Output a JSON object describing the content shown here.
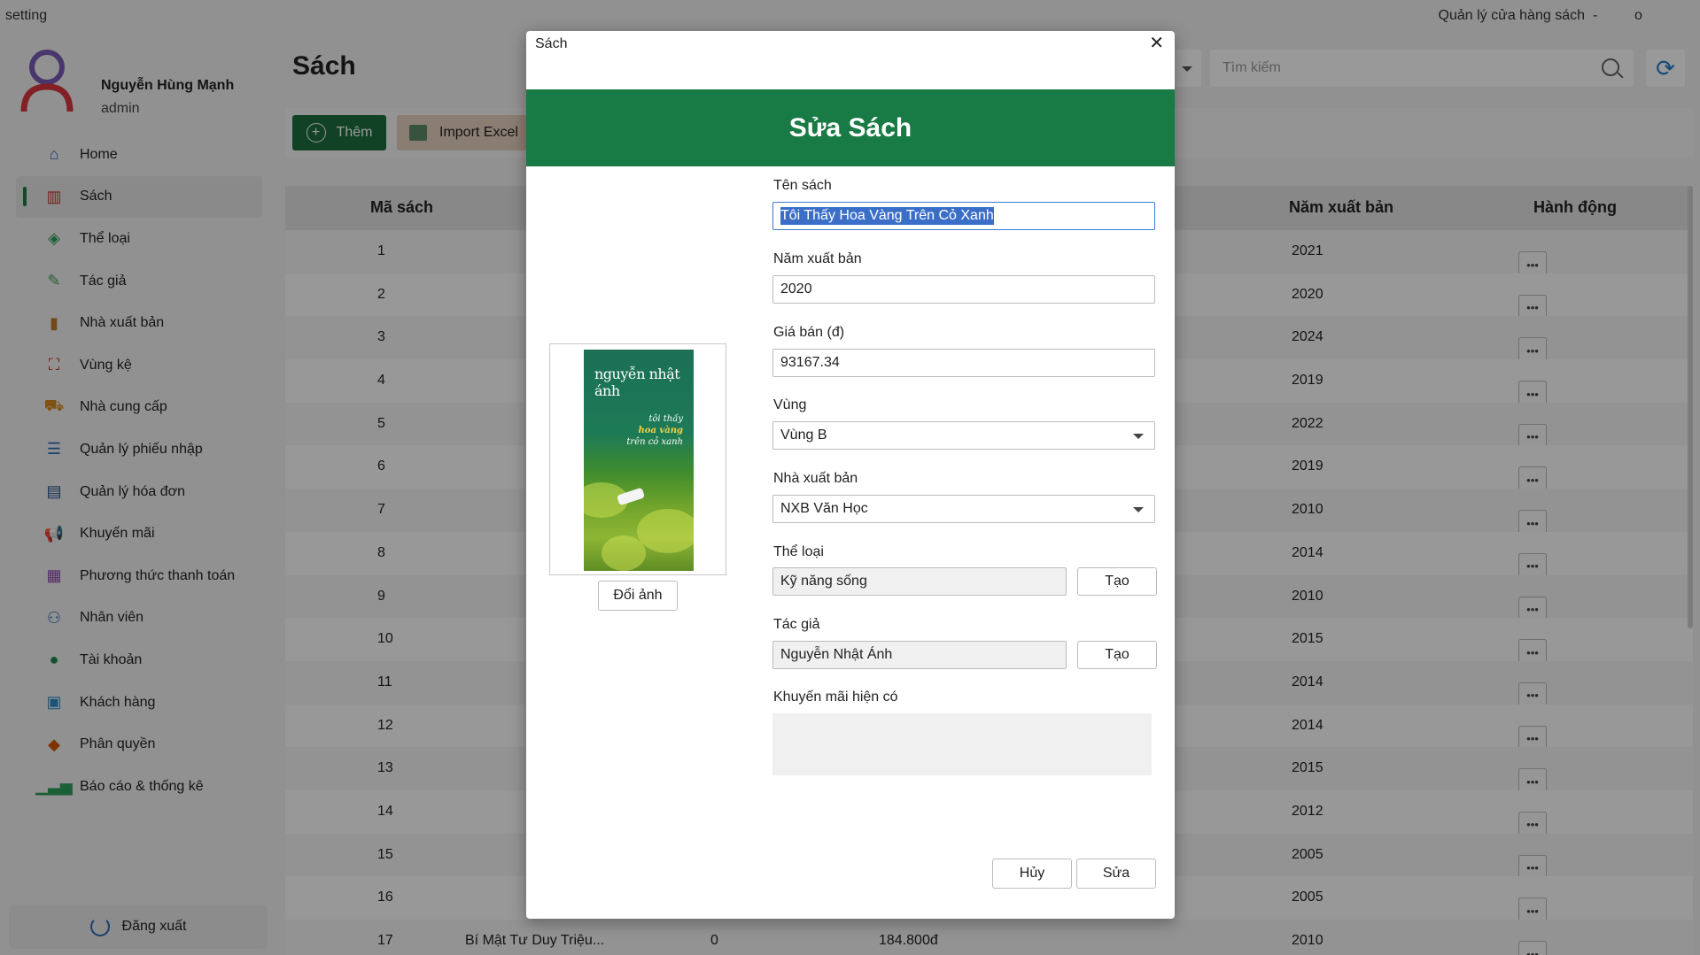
{
  "window": {
    "left_title": "setting",
    "right_title": "Quản lý cửa hàng sách",
    "minimize": "-",
    "maximize": "o"
  },
  "user": {
    "name": "Nguyễn Hùng Mạnh",
    "role": "admin"
  },
  "sidebar": {
    "items": [
      {
        "label": "Home",
        "icon": "home-icon",
        "color": "#2a6ab5",
        "glyph": "⌂"
      },
      {
        "label": "Sách",
        "icon": "books-icon",
        "color": "#c0392b",
        "glyph": "▥",
        "active": true
      },
      {
        "label": "Thể loại",
        "icon": "shapes-icon",
        "color": "#2e9e5b",
        "glyph": "◈"
      },
      {
        "label": "Tác giả",
        "icon": "author-icon",
        "color": "#4a9e5c",
        "glyph": "✎"
      },
      {
        "label": "Nhà xuất bản",
        "icon": "publisher-icon",
        "color": "#c07a2b",
        "glyph": "▮"
      },
      {
        "label": "Vùng kệ",
        "icon": "shelf-area-icon",
        "color": "#c0392b",
        "glyph": "⛶"
      },
      {
        "label": "Nhà cung cấp",
        "icon": "supplier-icon",
        "color": "#d48a1e",
        "glyph": "⛟"
      },
      {
        "label": "Quản lý phiếu nhập",
        "icon": "checklist-icon",
        "color": "#2a6ab5",
        "glyph": "☰"
      },
      {
        "label": "Quản lý hóa đơn",
        "icon": "invoice-icon",
        "color": "#1e4e8c",
        "glyph": "▤"
      },
      {
        "label": "Khuyến mãi",
        "icon": "megaphone-icon",
        "color": "#c0392b",
        "glyph": "📢"
      },
      {
        "label": "Phương thức thanh toán",
        "icon": "payment-icon",
        "color": "#8e44ad",
        "glyph": "▦"
      },
      {
        "label": "Nhân viên",
        "icon": "staff-icon",
        "color": "#2a6ab5",
        "glyph": "⚇"
      },
      {
        "label": "Tài khoản",
        "icon": "account-icon",
        "color": "#1e8a4c",
        "glyph": "●"
      },
      {
        "label": "Khách hàng",
        "icon": "customer-icon",
        "color": "#2a8ac8",
        "glyph": "▣"
      },
      {
        "label": "Phân quyền",
        "icon": "layers-icon",
        "color": "#d35400",
        "glyph": "◆"
      },
      {
        "label": "Báo cáo & thống kê",
        "icon": "chart-icon",
        "color": "#2e9e5b",
        "glyph": "▁▃▅"
      }
    ],
    "logout": "Đăng xuất"
  },
  "main": {
    "title": "Sách",
    "add_label": "Thêm",
    "import_label": "Import Excel",
    "search_placeholder": "Tìm kiếm",
    "columns": {
      "id": "Mã sách",
      "year": "Năm xuất bản",
      "actions": "Hành động"
    },
    "rows": [
      {
        "id": "1",
        "year": "2021"
      },
      {
        "id": "2",
        "year": "2020"
      },
      {
        "id": "3",
        "year": "2024"
      },
      {
        "id": "4",
        "year": "2019"
      },
      {
        "id": "5",
        "year": "2022"
      },
      {
        "id": "6",
        "year": "2019"
      },
      {
        "id": "7",
        "year": "2010"
      },
      {
        "id": "8",
        "year": "2014"
      },
      {
        "id": "9",
        "year": "2010"
      },
      {
        "id": "10",
        "year": "2015"
      },
      {
        "id": "11",
        "year": "2014"
      },
      {
        "id": "12",
        "year": "2014"
      },
      {
        "id": "13",
        "year": "2015"
      },
      {
        "id": "14",
        "year": "2012"
      },
      {
        "id": "15",
        "year": "2005"
      },
      {
        "id": "16",
        "year": "2005"
      },
      {
        "id": "17",
        "year": "2010",
        "title": "Bí Mật Tư Duy Triệu...",
        "qty": "0",
        "price": "184.800đ"
      }
    ]
  },
  "dialog": {
    "window_title": "Sách",
    "close": "✕",
    "header": "Sửa Sách",
    "cover": {
      "author_line": "nguyễn nhật ánh",
      "title_1": "tôi thấy",
      "title_2": "hoa vàng",
      "title_3": "trên cỏ xanh"
    },
    "change_image": "Đổi ảnh",
    "fields": {
      "name_label": "Tên sách",
      "name_value": "Tôi Thấy Hoa Vàng Trên Cỏ Xanh",
      "year_label": "Năm xuất bản",
      "year_value": "2020",
      "price_label": "Giá bán (đ)",
      "price_value": "93167.34",
      "zone_label": "Vùng",
      "zone_value": "Vùng B",
      "publisher_label": "Nhà xuất bản",
      "publisher_value": "NXB Văn Học",
      "genre_label": "Thể loại",
      "genre_value": "Kỹ năng sống",
      "genre_create": "Tạo",
      "author_label": "Tác giả",
      "author_value": "Nguyễn Nhật Ánh",
      "author_create": "Tạo",
      "promo_label": "Khuyến mãi hiện có"
    },
    "cancel": "Hủy",
    "submit": "Sửa"
  }
}
